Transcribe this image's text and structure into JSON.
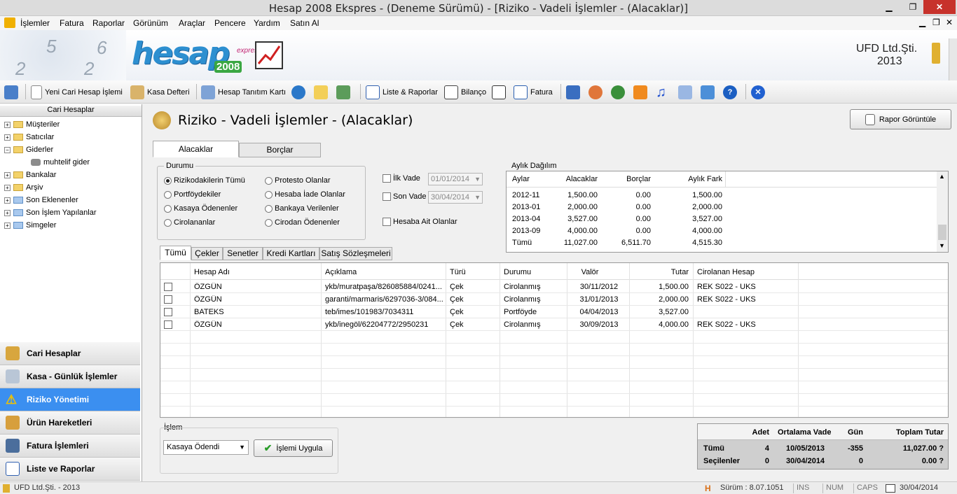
{
  "window": {
    "title": "Hesap 2008 Ekspres - (Deneme Sürümü) - [Riziko - Vadeli İşlemler  - (Alacaklar)]"
  },
  "menu": [
    "İşlemler",
    "Fatura",
    "Raporlar",
    "Görünüm",
    "Araçlar",
    "Pencere",
    "Yardım",
    "Satın Al"
  ],
  "banner": {
    "logo_text": "hesap",
    "logo_year": "2008",
    "logo_sub": "express",
    "company": "UFD Ltd.Şti.",
    "year": "2013"
  },
  "toolbar": {
    "new_account": "Yeni Cari Hesap İşlemi",
    "cash_book": "Kasa Defteri",
    "account_card": "Hesap Tanıtım Kartı",
    "lists_reports": "Liste & Raporlar",
    "balance": "Bilanço",
    "invoice": "Fatura"
  },
  "tree": {
    "header": "Cari Hesaplar",
    "items": [
      "Müşteriler",
      "Satıcılar",
      "Giderler",
      "muhtelif gider",
      "Bankalar",
      "Arşiv",
      "Son Eklenenler",
      "Son İşlem Yapılanlar",
      "Simgeler"
    ]
  },
  "nav": [
    "Cari Hesaplar",
    "Kasa - Günlük İşlemler",
    "Riziko Yönetimi",
    "Ürün Hareketleri",
    "Fatura İşlemleri",
    "Liste ve Raporlar"
  ],
  "page": {
    "title": "Riziko - Vadeli İşlemler  - (Alacaklar)",
    "report_button": "Rapor Görüntüle"
  },
  "tabs": {
    "main": [
      "Alacaklar",
      "Borçlar"
    ],
    "sub": [
      "Tümü",
      "Çekler",
      "Senetler",
      "Kredi Kartları",
      "Satış Sözleşmeleri"
    ]
  },
  "filters": {
    "group_label": "Durumu",
    "radios": [
      "Rizikodakilerin Tümü",
      "Portföydekiler",
      "Kasaya Ödenenler",
      "Cirolananlar",
      "Protesto Olanlar",
      "Hesaba İade Olanlar",
      "Bankaya Verilenler",
      "Cirodan Ödenenler"
    ],
    "first_due_label": "İlk Vade",
    "first_due_value": "01/01/2014",
    "last_due_label": "Son Vade",
    "last_due_value": "30/04/2014",
    "account_only": "Hesaba Ait Olanlar"
  },
  "monthly": {
    "label": "Aylık Dağılım",
    "headers": [
      "Aylar",
      "Alacaklar",
      "Borçlar",
      "Aylık Fark"
    ],
    "rows": [
      [
        "2012-11",
        "1,500.00",
        "0.00",
        "1,500.00"
      ],
      [
        "2013-01",
        "2,000.00",
        "0.00",
        "2,000.00"
      ],
      [
        "2013-04",
        "3,527.00",
        "0.00",
        "3,527.00"
      ],
      [
        "2013-09",
        "4,000.00",
        "0.00",
        "4,000.00"
      ],
      [
        "Tümü",
        "11,027.00",
        "6,511.70",
        "4,515.30"
      ]
    ]
  },
  "table": {
    "headers": [
      "Hesap Adı",
      "Açıklama",
      "Türü",
      "Durumu",
      "Valör",
      "Tutar",
      "Cirolanan Hesap"
    ],
    "rows": [
      [
        "ÖZGÜN",
        "ykb/muratpaşa/826085884/0241...",
        "Çek",
        "Cirolanmış",
        "30/11/2012",
        "1,500.00",
        "REK S022 - UKS"
      ],
      [
        "ÖZGÜN",
        "garanti/marmaris/6297036-3/084...",
        "Çek",
        "Cirolanmış",
        "31/01/2013",
        "2,000.00",
        "REK S022 - UKS"
      ],
      [
        "BATEKS",
        "teb/imes/101983/7034311",
        "Çek",
        "Portföyde",
        "04/04/2013",
        "3,527.00",
        ""
      ],
      [
        "ÖZGÜN",
        "ykb/inegöl/62204772/2950231",
        "Çek",
        "Cirolanmış",
        "30/09/2013",
        "4,000.00",
        "REK S022 - UKS"
      ]
    ]
  },
  "action": {
    "label": "İşlem",
    "selected": "Kasaya Ödendi",
    "apply": "İşlemi Uygula"
  },
  "summary": {
    "headers": [
      "Adet",
      "Ortalama Vade",
      "Gün",
      "Toplam Tutar"
    ],
    "rows": [
      [
        "Tümü",
        "4",
        "10/05/2013",
        "-355",
        "11,027.00 ?"
      ],
      [
        "Seçilenler",
        "0",
        "30/04/2014",
        "0",
        "0.00 ?"
      ]
    ]
  },
  "status": {
    "company": "UFD Ltd.Şti. - 2013",
    "version": "Sürüm : 8.07.1051",
    "ins": "INS",
    "num": "NUM",
    "caps": "CAPS",
    "date": "30/04/2014"
  },
  "colors": {
    "accent": "#3b8ff0",
    "warning": "#f2c200"
  }
}
